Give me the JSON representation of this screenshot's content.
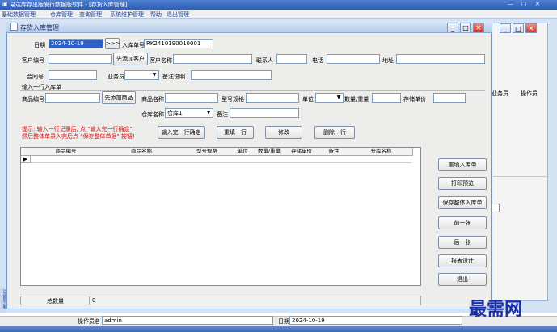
{
  "app": {
    "title": "易达库存出版发行数据版软件 - [存货入库管理]",
    "menu": [
      "基础数据管理",
      "仓库管理",
      "查询管理",
      "系统维护管理",
      "帮助",
      "退出管理"
    ]
  },
  "window": {
    "title": "存货入库管理"
  },
  "form": {
    "date_label": "日期",
    "date_value": "2024-10-19",
    "nav_btn": ">>>",
    "receipt_no_label": "入库单号",
    "receipt_no_value": "RK2410190010001",
    "customer_no_label": "客户编号",
    "add_customer_btn": "先添加客户",
    "customer_name_label": "客户名称",
    "contact_label": "联系人",
    "phone_label": "电话",
    "address_label": "地址",
    "contract_label": "合同号",
    "salesman_label": "业务员",
    "remark_label": "备注说明"
  },
  "line_entry": {
    "group_label": "输入一行入库单",
    "product_no_label": "商品编号",
    "add_product_btn": "先添加商品",
    "product_name_label": "商品名称",
    "model_label": "型号规格",
    "unit_label": "单位",
    "qty_label": "数量/重量",
    "price_label": "存储单价",
    "warehouse_label": "仓库名称",
    "warehouse_value": "仓库1",
    "note_label": "备注"
  },
  "hint": {
    "line1": "提示: 输入一行记录后, 点 \"输入完一行确定\"",
    "line2": "然后整体单录入完后点 \"保存整体单据\" 按钮!"
  },
  "actions": {
    "confirm_row": "输入完一行确定",
    "refill_row": "重填一行",
    "edit": "修改",
    "delete_row": "删除一行"
  },
  "table": {
    "columns": [
      "商品编号",
      "商品名称",
      "型号规格",
      "单位",
      "数量/重量",
      "存储单价",
      "备注",
      "仓库名称"
    ],
    "rows": []
  },
  "side_buttons": [
    "重填入库单",
    "打印预览",
    "保存整体入库单",
    "前一张",
    "后一张",
    "报表设计",
    "退出"
  ],
  "right_panel": {
    "col1": "业务员",
    "col2": "操作员"
  },
  "footer": {
    "total_label": "总数量",
    "total_value": "0"
  },
  "statusbar": {
    "operator_label": "操作员名",
    "operator_value": "admin",
    "date_label": "日期",
    "date_value": "2024-10-19"
  },
  "left_strip": "功能导航",
  "watermark": "最需网"
}
